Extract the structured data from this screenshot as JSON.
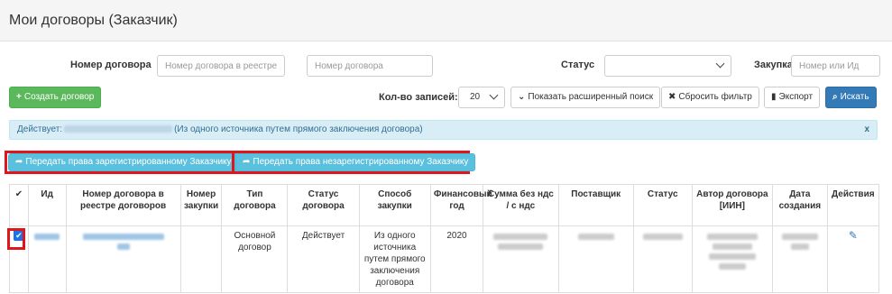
{
  "header": {
    "title": "Мои договоры (Заказчик)"
  },
  "filters": {
    "contract_number_label": "Номер договора",
    "registry_placeholder": "Номер договора в реестре ,",
    "number_placeholder": "Номер договора",
    "status_label": "Статус",
    "purchase_label": "Закупка",
    "purchase_placeholder": "Номер или Ид"
  },
  "toolbar": {
    "create_label": "Создать договор",
    "records_label": "Кол-во записей:",
    "records_value": "20",
    "advanced_label": "Показать расширенный поиск",
    "reset_label": "Сбросить фильтр",
    "export_label": "Экспорт",
    "search_label": "Искать"
  },
  "alert": {
    "prefix": "Действует:",
    "suffix": "(Из одного источника путем прямого заключения договора)",
    "close": "x"
  },
  "transfer": {
    "registered_label": "Передать права зарегистрированному Заказчику",
    "unregistered_label": "Передать права незарегистрированному Заказчику"
  },
  "table": {
    "headers": [
      "✔",
      "Ид",
      "Номер договора в реестре договоров",
      "Номер закупки",
      "Тип договора",
      "Статус договора",
      "Способ закупки",
      "Финансовый год",
      "Сумма без ндс / с ндс",
      "Поставщик",
      "Статус",
      "Автор договора [ИИН]",
      "Дата создания",
      "Действия"
    ],
    "row": {
      "contract_type": "Основной договор",
      "contract_status": "Действует",
      "method": "Из одного источника путем прямого заключения договора",
      "year": "2020"
    }
  },
  "icons": {
    "plus": "plus-icon",
    "chevron": "chevron-down-icon",
    "close": "close-icon",
    "file": "file-icon",
    "search": "search-icon",
    "share": "share-icon",
    "pencil": "pencil-icon",
    "check": "check-icon"
  },
  "colors": {
    "success": "#5cb85c",
    "primary": "#337ab7",
    "info": "#5bc0de",
    "alert_bg": "#d9edf7",
    "highlight": "#e0161b"
  }
}
